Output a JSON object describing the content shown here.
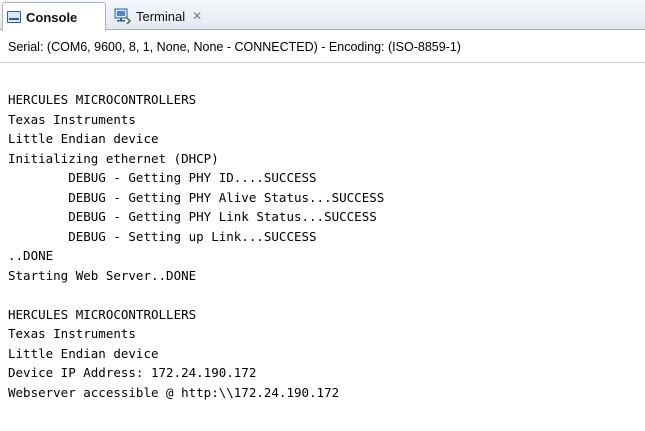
{
  "tabs": [
    {
      "label": "Console",
      "icon": "console-icon",
      "active": true
    },
    {
      "label": "Terminal",
      "icon": "terminal-icon",
      "active": false,
      "close": "✕"
    }
  ],
  "status": "Serial: (COM6, 9600, 8, 1, None, None - CONNECTED) - Encoding: (ISO-8859-1)",
  "console_lines": [
    "HERCULES MICROCONTROLLERS",
    "Texas Instruments",
    "Little Endian device",
    "Initializing ethernet (DHCP)",
    "        DEBUG - Getting PHY ID....SUCCESS",
    "        DEBUG - Getting PHY Alive Status...SUCCESS",
    "        DEBUG - Getting PHY Link Status...SUCCESS",
    "        DEBUG - Setting up Link...SUCCESS",
    "..DONE",
    "Starting Web Server..DONE",
    "",
    "HERCULES MICROCONTROLLERS",
    "Texas Instruments",
    "Little Endian device",
    "Device IP Address: 172.24.190.172",
    "Webserver accessible @ http:\\\\172.24.190.172"
  ]
}
